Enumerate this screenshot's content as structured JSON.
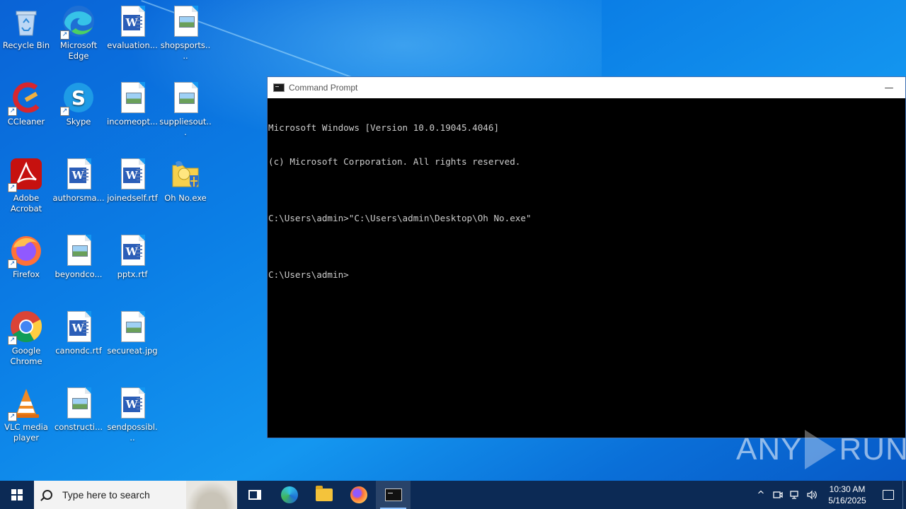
{
  "desktop": {
    "icons": [
      {
        "label": "Recycle Bin",
        "icon": "recycle-bin-icon"
      },
      {
        "label": "Microsoft Edge",
        "icon": "edge-icon"
      },
      {
        "label": "evaluation...",
        "icon": "word-doc-icon"
      },
      {
        "label": "shopsports....",
        "icon": "image-file-icon"
      },
      {
        "label": "CCleaner",
        "icon": "ccleaner-icon"
      },
      {
        "label": "Skype",
        "icon": "skype-icon"
      },
      {
        "label": "incomeopt...",
        "icon": "image-file-icon"
      },
      {
        "label": "suppliesout...",
        "icon": "image-file-icon"
      },
      {
        "label": "Adobe Acrobat",
        "icon": "acrobat-icon"
      },
      {
        "label": "authorsma...",
        "icon": "word-doc-icon"
      },
      {
        "label": "joinedself.rtf",
        "icon": "word-doc-icon"
      },
      {
        "label": "Oh No.exe",
        "icon": "exe-file-icon"
      },
      {
        "label": "Firefox",
        "icon": "firefox-icon"
      },
      {
        "label": "beyondco...",
        "icon": "image-file-icon"
      },
      {
        "label": "pptx.rtf",
        "icon": "word-doc-icon"
      },
      {
        "label": "Google Chrome",
        "icon": "chrome-icon"
      },
      {
        "label": "canondc.rtf",
        "icon": "word-doc-icon"
      },
      {
        "label": "secureat.jpg",
        "icon": "image-file-icon"
      },
      {
        "label": "VLC media player",
        "icon": "vlc-icon"
      },
      {
        "label": "constructi...",
        "icon": "image-file-icon"
      },
      {
        "label": "sendpossibl...",
        "icon": "word-doc-icon"
      }
    ]
  },
  "cmd_window": {
    "title": "Command Prompt",
    "minimize_glyph": "—",
    "lines": [
      "Microsoft Windows [Version 10.0.19045.4046]",
      "(c) Microsoft Corporation. All rights reserved.",
      "",
      "C:\\Users\\admin>\"C:\\Users\\admin\\Desktop\\Oh No.exe\"",
      "",
      "C:\\Users\\admin>"
    ]
  },
  "watermark": {
    "left": "ANY",
    "right": "RUN"
  },
  "taskbar": {
    "search_placeholder": "Type here to search",
    "apps": [
      "task-view",
      "microsoft-edge",
      "file-explorer",
      "firefox",
      "command-prompt"
    ],
    "active_app": "command-prompt",
    "tray": {
      "chevron": "^",
      "time": "10:30 AM",
      "date": "5/16/2025"
    }
  },
  "colors": {
    "desktop_blue": "#0b7fe6",
    "taskbar": "#0c2a55",
    "console_bg": "#000000",
    "console_text": "#cccccc"
  }
}
